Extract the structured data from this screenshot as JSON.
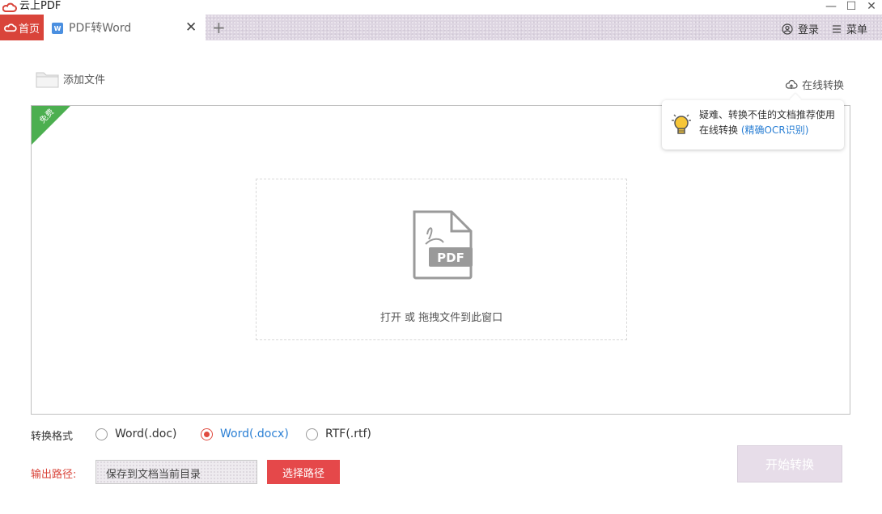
{
  "window": {
    "title": "云上PDF",
    "controls": [
      "minimize",
      "maximize",
      "close"
    ]
  },
  "tabs": {
    "home_label": "首页",
    "active_tab_label": "PDF转Word",
    "add_tab_icon": "plus-icon"
  },
  "header": {
    "login_label": "登录",
    "menu_label": "菜单"
  },
  "toolbar": {
    "add_file_label": "添加文件",
    "online_convert_label": "在线转换"
  },
  "tooltip": {
    "text": "疑难、转换不佳的文档推荐使用在线转换",
    "link_text": "(精确OCR识别)"
  },
  "drop_zone": {
    "badge_text": "免费",
    "file_type_label": "PDF",
    "hint": "打开 或 拖拽文件到此窗口"
  },
  "format": {
    "label": "转换格式",
    "options": [
      {
        "label": "Word(.doc)",
        "checked": false
      },
      {
        "label": "Word(.docx)",
        "checked": true
      },
      {
        "label": "RTF(.rtf)",
        "checked": false
      }
    ]
  },
  "output": {
    "label": "输出路径:",
    "path_value": "保存到文档当前目录",
    "choose_button": "选择路径"
  },
  "start_button": "开始转换",
  "colors": {
    "brand_red": "#d9443a",
    "link_blue": "#2a7fd4",
    "badge_green": "#4caf50"
  }
}
